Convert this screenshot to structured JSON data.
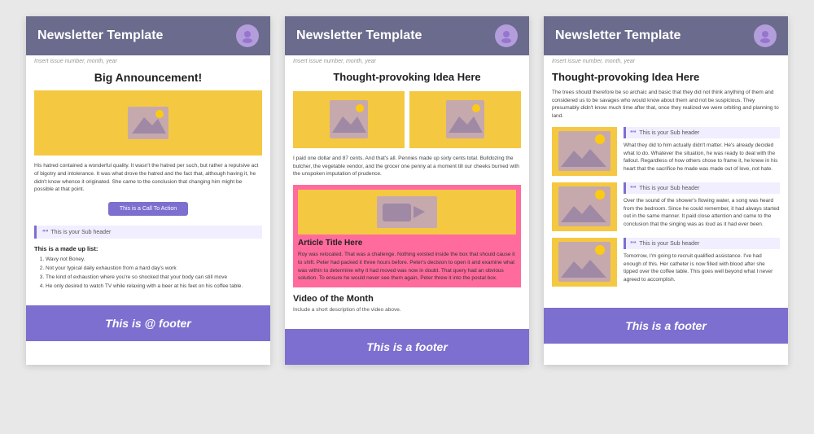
{
  "templates": [
    {
      "id": "template-1",
      "header": {
        "title": "Newsletter Template",
        "avatar_text": "😊"
      },
      "issue_line": "Insert issue number, month, year",
      "big_announcement": "Big Announcement!",
      "body_text": "His hatred contained a wonderful quality. It wasn't the hatred per such, but rather a repulsive act of bigotry and intolerance. It was what drove the hatred and the fact that, although having it, he didn't know whence it originated. She came to the conclusion that changing him might be possible at that point.",
      "cta_label": "This is a Call To Action",
      "subheader_label": "This is your Sub header",
      "list_title": "This is a made up list:",
      "list_items": [
        "Wavy not Boney.",
        "Not your typical daily exhaustion from a hard day's work",
        "The kind of exhaustion where you're so shocked that your body can still move",
        "He only desired to watch TV while relaxing with a beer at his feet on his coffee table."
      ],
      "footer": "This is @ footer"
    },
    {
      "id": "template-2",
      "header": {
        "title": "Newsletter Template",
        "avatar_text": "😊"
      },
      "issue_line": "Insert issue number, month, year",
      "headline": "Thought-provoking Idea Here",
      "body_text": "I paid one dollar and 87 cents. And that's all. Pennies made up sixty cents total. Bulldozing the butcher, the vegetable vendor, and the grocer one penny at a moment till our cheeks burned with the unspoken imputation of prudence.",
      "article_title": "Article Title Here",
      "article_text": "Roy was relocated. That was a challenge. Nothing existed inside the box that should cause it to shift. Peter had packed it three hours before. Peter's decision to open it and examine what was within to determine why it had moved was now in doubt. That query had an obvious solution. To ensure he would never see them again, Peter threw it into the postal box.",
      "video_title": "Video of the Month",
      "video_desc": "Include a short description of the video above.",
      "footer": "This is a footer"
    },
    {
      "id": "template-3",
      "header": {
        "title": "Newsletter Template",
        "avatar_text": "😊"
      },
      "issue_line": "Insert issue number, month, year",
      "headline": "Thought-provoking Idea Here",
      "intro_text": "The trees should therefore be so archaic and basic that they did not think anything of them and considered us to be savages who would know about them and not be suspicious. They presumably didn't know much time after that, once they realized we were orbiting and planning to land.",
      "subheader_1": "This is your Sub header",
      "text_1": "What they did to him actually didn't matter. He's already decided what to do. Whatever the situation, he was ready to deal with the fallout. Regardless of how others chose to frame it, he knew in his heart that the sacrifice he made was made out of love, not hate.",
      "subheader_2": "This is your Sub header",
      "text_2": "Over the sound of the shower's flowing water, a song was heard from the bedroom. Since he could remember, it had always started out in the same manner. It paid close attention and came to the conclusion that the singing was as loud as it had ever been.",
      "subheader_3": "This is your Sub header",
      "text_3": "Tomorrow, I'm going to recruit qualified assistance. I've had enough of this. Her catheter is now filled with blood after she tipped over the coffee table. This goes well beyond what I never agreed to accomplish.",
      "footer": "This is a footer"
    }
  ],
  "icons": {
    "avatar": "🖼",
    "quote": "❝"
  }
}
